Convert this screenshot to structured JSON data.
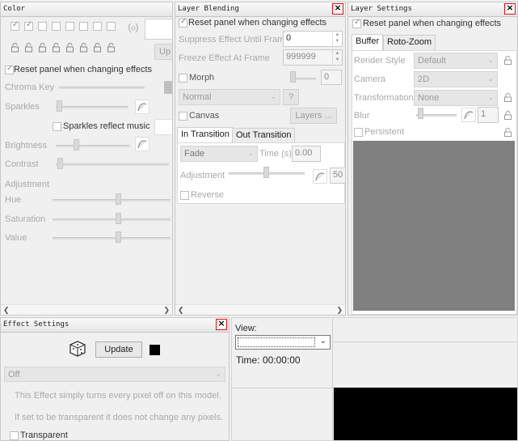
{
  "color_panel": {
    "title": "Color",
    "reset_label": "Reset panel when changing effects",
    "update_label": "Up",
    "chroma_key_label": "Chroma Key",
    "sparkles_label": "Sparkles",
    "sparkles_music_label": "Sparkles reflect music",
    "brightness_label": "Brightness",
    "contrast_label": "Contrast",
    "adjustment_label": "Adjustment",
    "hue_label": "Hue",
    "saturation_label": "Saturation",
    "value_label": "Value",
    "palette_checks": [
      true,
      true,
      false,
      false,
      false,
      false,
      false,
      false
    ]
  },
  "layer_blending": {
    "title": "Layer Blending",
    "reset_label": "Reset panel when changing effects",
    "suppress_label": "Suppress Effect Until Frame",
    "suppress_value": "0",
    "freeze_label": "Freeze Effect At Frame",
    "freeze_value": "999999",
    "morph_label": "Morph",
    "morph_value": "0",
    "blend_mode": "Normal",
    "help_label": "?",
    "canvas_label": "Canvas",
    "layers_label": "Layers ...",
    "tab_in": "In Transition",
    "tab_out": "Out Transition",
    "transition_type": "Fade",
    "time_label": "Time (s)",
    "time_value": "0.00",
    "adjustment_label": "Adjustment",
    "adjustment_value": "50",
    "reverse_label": "Reverse"
  },
  "layer_settings": {
    "title": "Layer Settings",
    "reset_label": "Reset panel when changing effects",
    "tab_buffer": "Buffer",
    "tab_rotozoom": "Roto-Zoom",
    "render_style_label": "Render Style",
    "render_style_value": "Default",
    "camera_label": "Camera",
    "camera_value": "2D",
    "transformation_label": "Transformation",
    "transformation_value": "None",
    "blur_label": "Blur",
    "blur_value": "1",
    "persistent_label": "Persistent",
    "preview_color": "#808080"
  },
  "effect_settings": {
    "title": "Effect Settings",
    "update_label": "Update",
    "effect_value": "Off",
    "description_1": "This Effect simply turns every pixel off on this model.",
    "description_2": "If set to be transparent it does not change any pixels.",
    "transparent_label": "Transparent",
    "swatch_color": "#000000"
  },
  "view_panel": {
    "view_label": "View:",
    "view_value": "",
    "time_label": "Time: 00:00:00",
    "preview_color": "#000000"
  },
  "icons": {
    "close": "close-icon",
    "lock": "lock-icon",
    "dice": "dice-icon",
    "valuecurve": "value-curve-icon",
    "scroll_left": "scroll-left-icon",
    "scroll_right": "scroll-right-icon"
  }
}
